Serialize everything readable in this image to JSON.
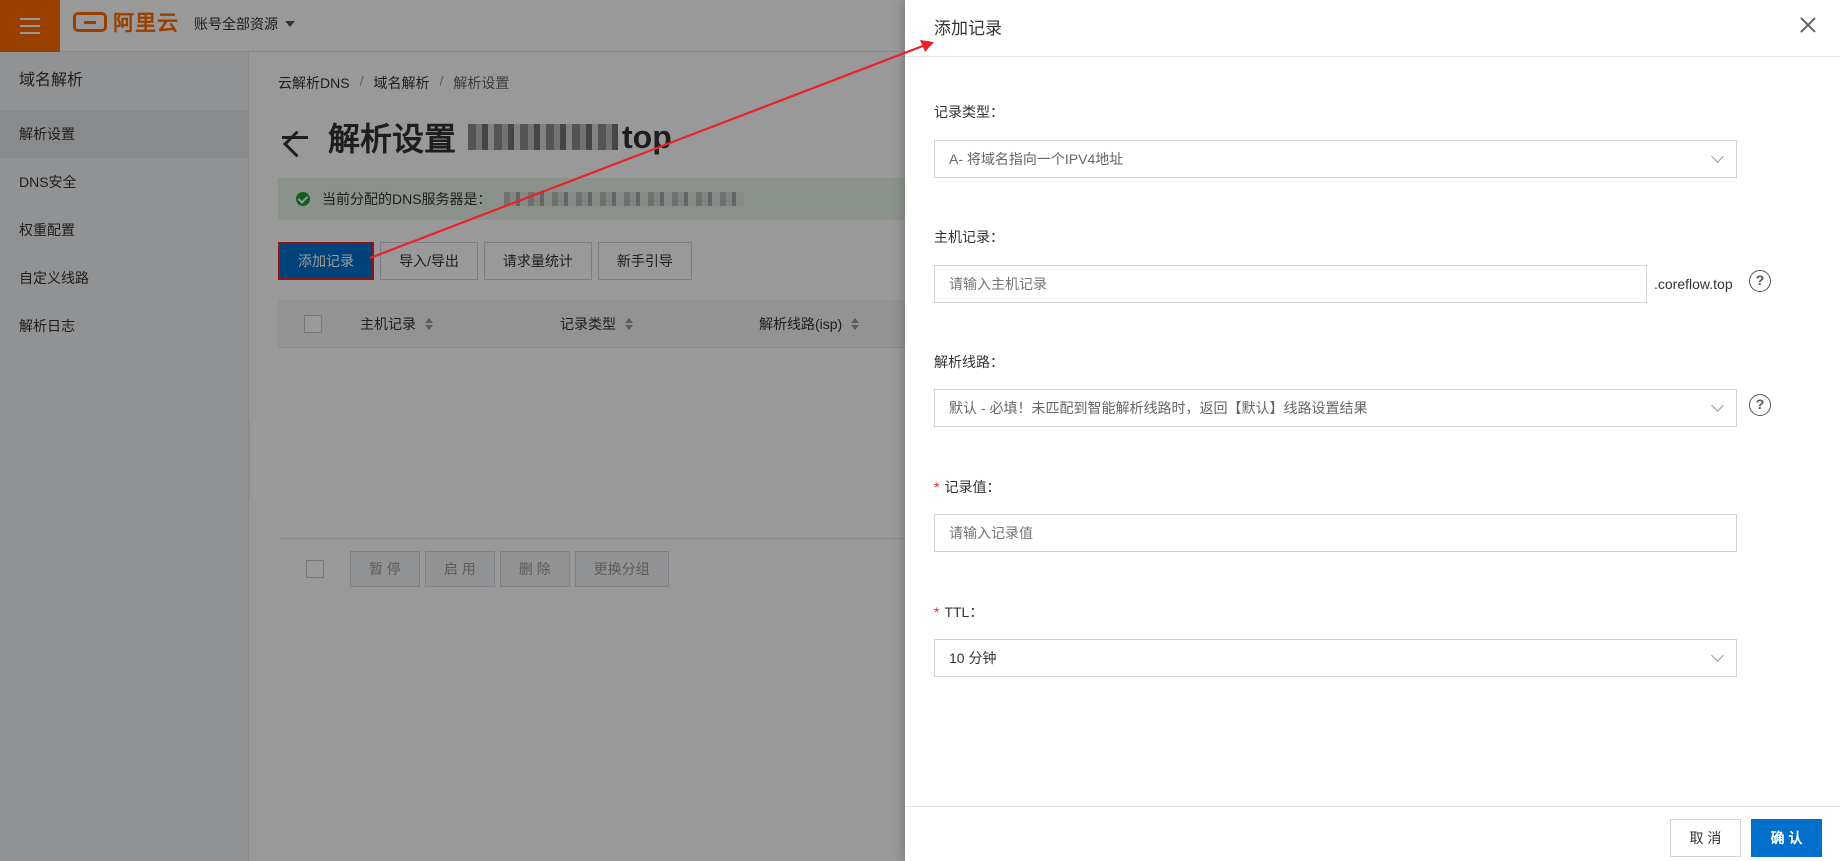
{
  "topbar": {
    "logo_text": "阿里云",
    "account_label": "账号全部资源"
  },
  "sidebar": {
    "title": "域名解析",
    "items": [
      {
        "label": "解析设置",
        "active": true
      },
      {
        "label": "DNS安全",
        "active": false
      },
      {
        "label": "权重配置",
        "active": false
      },
      {
        "label": "自定义线路",
        "active": false
      },
      {
        "label": "解析日志",
        "active": false
      }
    ]
  },
  "breadcrumb": [
    "云解析DNS",
    "域名解析",
    "解析设置"
  ],
  "page": {
    "title": "解析设置",
    "domain_suffix": "top",
    "dns_banner": "当前分配的DNS服务器是："
  },
  "toolbar": {
    "add_record": "添加记录",
    "import_export": "导入/导出",
    "request_stats": "请求量统计",
    "guide": "新手引导"
  },
  "table": {
    "columns": [
      "主机记录",
      "记录类型",
      "解析线路(isp)"
    ]
  },
  "footer_actions": [
    "暂 停",
    "启 用",
    "删 除",
    "更换分组"
  ],
  "drawer": {
    "title": "添加记录",
    "record_type_label": "记录类型：",
    "record_type_value": "A- 将域名指向一个IPV4地址",
    "host_label": "主机记录：",
    "host_placeholder": "请输入主机记录",
    "host_suffix": ".coreflow.top",
    "line_label": "解析线路：",
    "line_value": "默认 - 必填！未匹配到智能解析线路时，返回【默认】线路设置结果",
    "value_label": "记录值：",
    "value_placeholder": "请输入记录值",
    "ttl_label": "TTL：",
    "ttl_value": "10 分钟",
    "required_mark": "*",
    "help_glyph": "?",
    "cancel": "取 消",
    "confirm": "确 认"
  },
  "colors": {
    "brand": "#ff6a00",
    "primary": "#0070cc",
    "annotation": "#e8242b"
  }
}
